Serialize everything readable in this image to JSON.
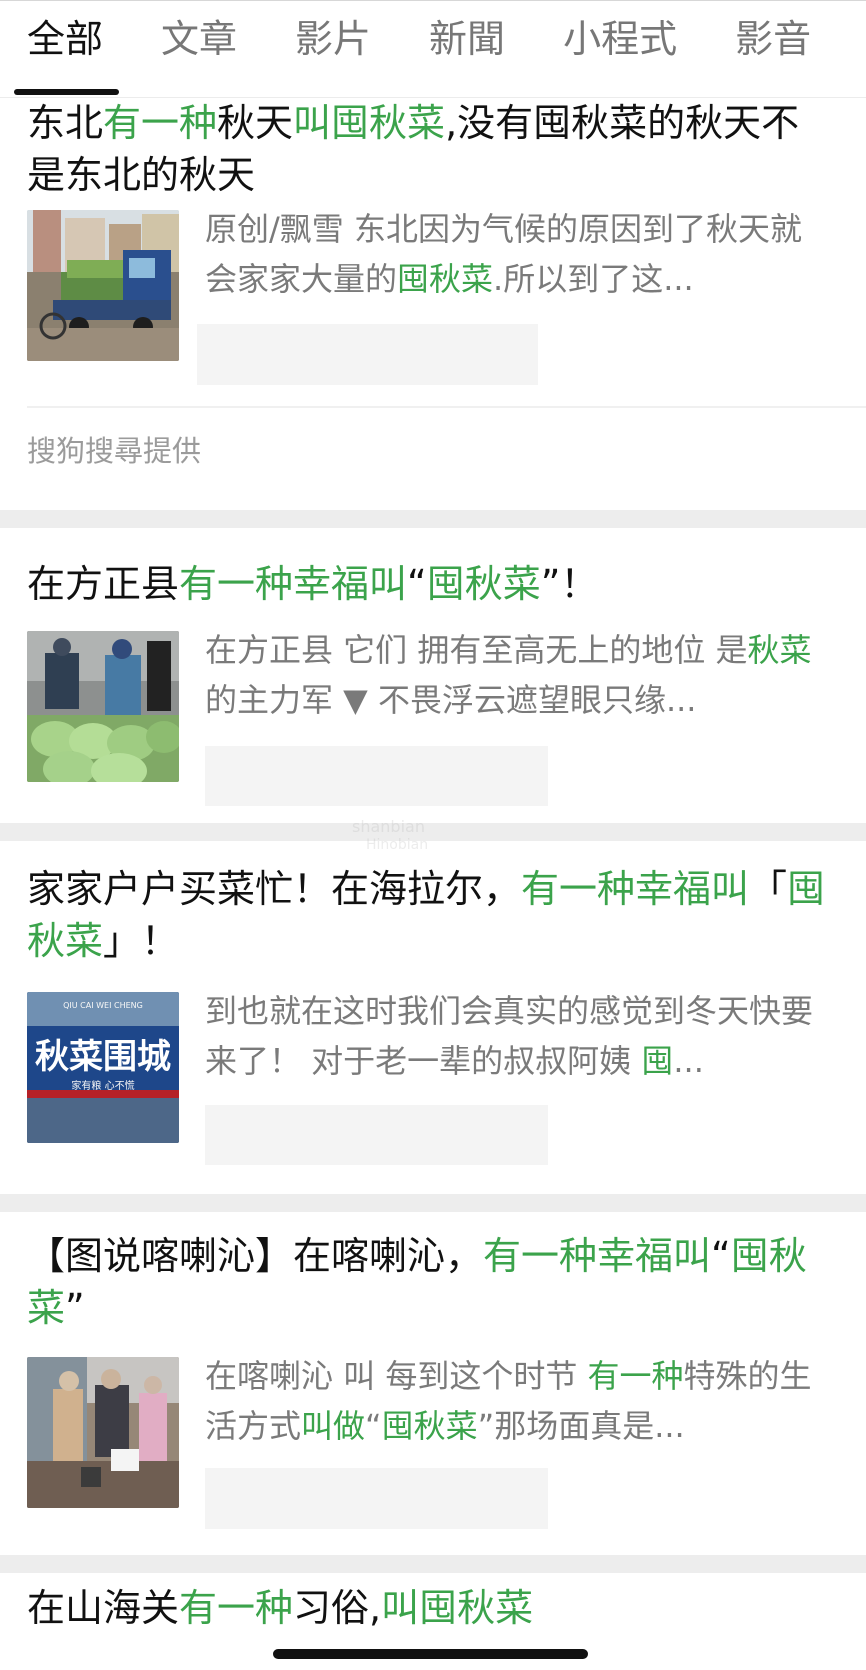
{
  "tabs": {
    "items": [
      "全部",
      "文章",
      "影片",
      "新聞",
      "小程式",
      "影音"
    ]
  },
  "results": [
    {
      "title": [
        {
          "text": "东北",
          "hl": false
        },
        {
          "text": "有一种",
          "hl": true
        },
        {
          "text": "秋天",
          "hl": false
        },
        {
          "text": "叫囤秋菜",
          "hl": true
        },
        {
          "text": ",没有囤秋菜的秋天不是东北的秋天",
          "hl": false
        }
      ],
      "snippet": [
        {
          "text": "原创/飘雪 东北因为气候的原因到了秋天就会家家大量的",
          "hl": false
        },
        {
          "text": "囤秋菜",
          "hl": true
        },
        {
          "text": ".所以到了这...",
          "hl": false
        }
      ]
    },
    {
      "title": [
        {
          "text": "在方正县",
          "hl": false
        },
        {
          "text": "有一种幸福叫",
          "hl": true
        },
        {
          "text": "“",
          "hl": false
        },
        {
          "text": "囤秋菜",
          "hl": true
        },
        {
          "text": "”！",
          "hl": false
        }
      ],
      "snippet": [
        {
          "text": "在方正县 它们 拥有至高无上的地位 是",
          "hl": false
        },
        {
          "text": "秋菜",
          "hl": true
        },
        {
          "text": "的主力军 ▼ 不畏浮云遮望眼只缘...",
          "hl": false
        }
      ]
    },
    {
      "title": [
        {
          "text": "家家户户买菜忙！在海拉尔，",
          "hl": false
        },
        {
          "text": "有一种幸福叫",
          "hl": true
        },
        {
          "text": "「",
          "hl": false
        },
        {
          "text": "囤秋菜",
          "hl": true
        },
        {
          "text": "」！",
          "hl": false
        }
      ],
      "snippet": [
        {
          "text": "到也就在这时我们会真实的感觉到冬天快要来了！ 对于老一辈的叔叔阿姨 ",
          "hl": false
        },
        {
          "text": "囤",
          "hl": true
        },
        {
          "text": "...",
          "hl": false
        }
      ]
    },
    {
      "title": [
        {
          "text": "【图说喀喇沁】在喀喇沁，",
          "hl": false
        },
        {
          "text": "有一种幸福叫",
          "hl": true
        },
        {
          "text": "“",
          "hl": false
        },
        {
          "text": "囤秋菜",
          "hl": true
        },
        {
          "text": "”",
          "hl": false
        }
      ],
      "snippet": [
        {
          "text": "在喀喇沁 叫 每到这个时节 ",
          "hl": false
        },
        {
          "text": "有一种",
          "hl": true
        },
        {
          "text": "特殊的生活方式",
          "hl": false
        },
        {
          "text": "叫做",
          "hl": true
        },
        {
          "text": "“",
          "hl": false
        },
        {
          "text": "囤秋菜",
          "hl": true
        },
        {
          "text": "”那场面真是...",
          "hl": false
        }
      ]
    },
    {
      "title": [
        {
          "text": "在山海关",
          "hl": false
        },
        {
          "text": "有一种",
          "hl": true
        },
        {
          "text": "习俗,",
          "hl": false
        },
        {
          "text": "叫囤秋菜",
          "hl": true
        }
      ]
    }
  ],
  "provider": {
    "label": "搜狗搜尋提供"
  },
  "thumbnails": {
    "card3_banner_text": "秋菜围城",
    "card3_banner_subtext": "家有粮  心不慌",
    "card3_top_text": "QIU CAI WEI CHENG"
  },
  "colors": {
    "highlight": "#3ba34b",
    "separator": "#ededed",
    "snippet": "#7a7a7a"
  }
}
